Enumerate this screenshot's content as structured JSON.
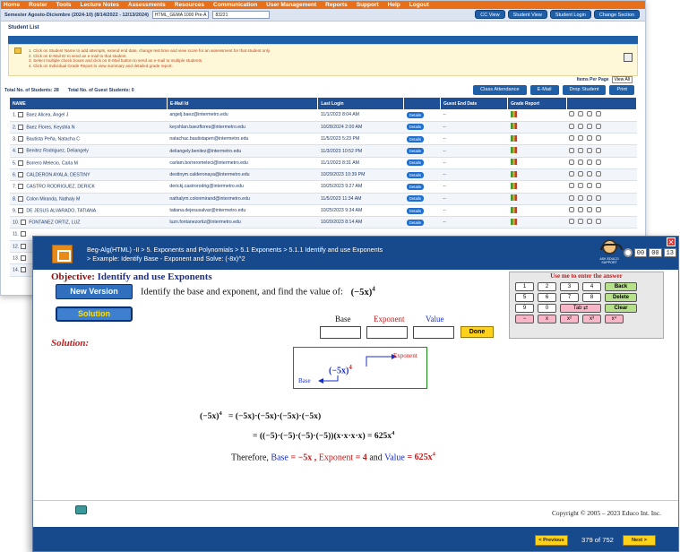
{
  "back_window": {
    "nav": [
      "Home",
      "Roster",
      "Tools",
      "Lecture Notes",
      "Assessments",
      "Resources",
      "Communication",
      "User Management",
      "Reports",
      "Support",
      "Help",
      "Logout"
    ],
    "semester_label": "Semester Agosto-Diciembre (2024-10) (8/14/2022 - 12/13/2024)",
    "course_select": "HTML_GEMA 1000 Pre-Á",
    "section_select": "83221",
    "top_buttons": [
      "CC View",
      "Student View",
      "Student Login",
      "Change Section"
    ],
    "title": "Student List",
    "instructions": [
      "1. Click on Student Name to add attempts, extend end date, change test time and view score for an assessment for that student only.",
      "2. Click on E-Mail ID to send an e-mail to that student.",
      "3. Select multiple check boxes and click on E-Mail button to send an e-mail to multiple students.",
      "4. Click on Individual Grade Report to view summary and detailed grade report."
    ],
    "items_per_page_label": "Items Per Page",
    "items_per_page_value": "View All",
    "total_students": "Total No. of Students: 28",
    "total_guests": "Total No. of Guest Students: 0",
    "action_buttons": [
      "Class Attendance",
      "E-Mail",
      "Drop Student",
      "Print"
    ],
    "columns": [
      "NAME",
      "E-Mail Id",
      "Last Login",
      "",
      "Guest End Date",
      "Grade Report",
      ""
    ],
    "details_label": "Details",
    "rows": [
      {
        "n": "1.",
        "name": "Baez Alicea, Angel J",
        "email": "angelj.baez@intermetro.edu",
        "login": "11/1/2023 8:04 AM",
        "guest": "--"
      },
      {
        "n": "2.",
        "name": "Baez Flores, Keyshla N",
        "email": "keyshlan.baezflores@intermetro.edu",
        "login": "10/28/2024 2:00 AM",
        "guest": "--"
      },
      {
        "n": "3.",
        "name": "Bautista Peña, Natacha C",
        "email": "natachac.bautistapen@intermetro.edu",
        "login": "11/5/2023 5:23 PM",
        "guest": "--"
      },
      {
        "n": "4.",
        "name": "Benitez Rodriguez, Deliangely",
        "email": "deliangely.benitez@intermetro.edu",
        "login": "11/3/2023 10:52 PM",
        "guest": "--"
      },
      {
        "n": "5.",
        "name": "Borrero Melecio, Carla M",
        "email": "carlam.borreromeleci@intermetro.edu",
        "login": "11/1/2023 8:31 AM",
        "guest": "--"
      },
      {
        "n": "6.",
        "name": "CALDERON AYALA, DESTINY",
        "email": "destinym.calderonaya@intermetro.edu",
        "login": "10/29/2023 10:39 PM",
        "guest": "--"
      },
      {
        "n": "7.",
        "name": "CASTRO RODRIGUEZ, DERICK",
        "email": "derickj.castrorodrig@intermetro.edu",
        "login": "10/25/2023 9:27 AM",
        "guest": "--"
      },
      {
        "n": "8.",
        "name": "Colon Miranda, Nathaly M",
        "email": "nathalym.colonmirand@intermetro.edu",
        "login": "11/5/2023 11:34 AM",
        "guest": "--"
      },
      {
        "n": "9.",
        "name": "DE JESUS ALVARADO, TATIANA",
        "email": "tatiana.dejesusalvar@intermetro.edu",
        "login": "10/25/2023 9:34 AM",
        "guest": "--"
      },
      {
        "n": "10.",
        "name": "FONTANEZ ORTIZ, LUZ",
        "email": "luzn.fontanezortiz@intermetro.edu",
        "login": "10/20/2023 8:14 AM",
        "guest": "--"
      },
      {
        "n": "11.",
        "name": "",
        "email": "",
        "login": "",
        "guest": ""
      },
      {
        "n": "12.",
        "name": "",
        "email": "",
        "login": "",
        "guest": ""
      },
      {
        "n": "13.",
        "name": "",
        "email": "",
        "login": "",
        "guest": ""
      },
      {
        "n": "14.",
        "name": "",
        "email": "",
        "login": "",
        "guest": ""
      }
    ]
  },
  "exercise": {
    "breadcrumb_1": "Beg-Alg(HTML) -II > 5. Exponents and Polynomials > 5.1 Exponents > 5.1.1 Identify and use Exponents",
    "breadcrumb_2": "> Example: Identify Base - Exponent and Solve: (-8x)^2",
    "support_label": "ASK EDUCO SUPPORT",
    "timer": [
      "00",
      "00",
      "13"
    ],
    "objective_label": "Objective:",
    "objective_value": "Identify and use Exponents",
    "new_version": "New Version",
    "solution_button": "Solution",
    "question_text": "Identify the base and exponent, and find the value of:",
    "question_expr": "(−5x)",
    "question_exp": "4",
    "base_label": "Base",
    "exponent_label": "Exponent",
    "value_label": "Value",
    "done": "Done",
    "keypad_title": "Use me to enter the answer",
    "keypad_rows": [
      [
        "1",
        "2",
        "3",
        "4",
        "Back"
      ],
      [
        "5",
        "6",
        "7",
        "8",
        "Delete"
      ],
      [
        "9",
        "0",
        "Tab ⇄",
        "Clear"
      ],
      [
        "−",
        "x",
        "x²",
        "x³",
        "x⁴"
      ]
    ],
    "solution_label": "Solution:",
    "diagram_expr": "(−5x)",
    "diagram_exp": "4",
    "diagram_exp_label": "Exponent",
    "diagram_base_label": "Base",
    "step1_lhs": "(−5x)",
    "step1_lhs_exp": "4",
    "step1_rhs": "= (−5x)·(−5x)·(−5x)·(−5x)",
    "step2": "= ((−5)·(−5)·(−5)·(−5))(x·x·x·x) = 625x",
    "step2_exp": "4",
    "therefore_prefix": "Therefore,",
    "therefore_base_label": "Base",
    "therefore_base_value": "= −5x ,",
    "therefore_exp_label": "Exponent",
    "therefore_exp_value": "= 4",
    "therefore_and": "and",
    "therefore_val_label": "Value",
    "therefore_val_value": "= 625x",
    "therefore_val_exp": "4",
    "copyright": "Copyright © 2005 – 2023 Educo Int. Inc.",
    "previous": "< Previous",
    "page_indicator": "379 of 752",
    "next": "Next >"
  }
}
